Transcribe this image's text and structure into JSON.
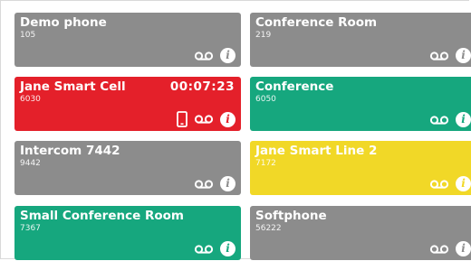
{
  "tiles": [
    {
      "name": "Demo phone",
      "extension": "105",
      "color": "#8c8c8c",
      "status": "idle",
      "icons": [
        "voicemail-icon",
        "info-icon"
      ]
    },
    {
      "name": "Conference Room",
      "extension": "219",
      "color": "#8c8c8c",
      "status": "idle",
      "icons": [
        "voicemail-icon",
        "info-icon"
      ]
    },
    {
      "name": "Jane Smart Cell",
      "extension": "6030",
      "color": "#e4202a",
      "status": "in-call",
      "timer": "00:07:23",
      "icons": [
        "mobile-phone-icon",
        "voicemail-icon",
        "info-icon"
      ]
    },
    {
      "name": "Conference",
      "extension": "6050",
      "color": "#16a77e",
      "status": "available",
      "icons": [
        "voicemail-icon",
        "info-icon"
      ]
    },
    {
      "name": "Intercom 7442",
      "extension": "9442",
      "color": "#8c8c8c",
      "status": "idle",
      "icons": [
        "voicemail-icon",
        "info-icon"
      ]
    },
    {
      "name": "Jane Smart Line 2",
      "extension": "7172",
      "color": "#f1d827",
      "status": "ringing",
      "icons": [
        "voicemail-icon",
        "info-icon"
      ]
    },
    {
      "name": "Small Conference Room",
      "extension": "7367",
      "color": "#16a77e",
      "status": "available",
      "icons": [
        "voicemail-icon",
        "info-icon"
      ]
    },
    {
      "name": "Softphone",
      "extension": "56222",
      "color": "#8c8c8c",
      "status": "idle",
      "icons": [
        "voicemail-icon",
        "info-icon"
      ]
    }
  ],
  "info_glyph": "i"
}
